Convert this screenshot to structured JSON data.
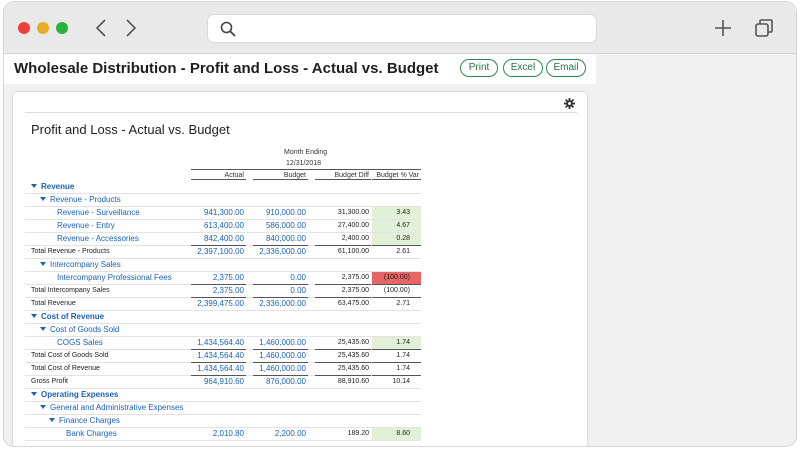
{
  "browser": {
    "url_placeholder": ""
  },
  "header": {
    "title": "Wholesale Distribution - Profit and Loss - Actual vs. Budget",
    "print": "Print",
    "excel": "Excel",
    "email": "Email"
  },
  "report": {
    "title": "Profit and Loss - Actual vs. Budget",
    "period_label": "Month Ending",
    "period_date": "12/31/2018",
    "columns": [
      "Actual",
      "Budget",
      "Budget Diff",
      "Budget % Var"
    ],
    "rows": [
      {
        "label": "Revenue",
        "level": 0,
        "style": "group",
        "caret": true
      },
      {
        "label": "Revenue - Products",
        "level": 1,
        "style": "group",
        "caret": true
      },
      {
        "label": "Revenue - Surveillance",
        "level": 2,
        "style": "item",
        "actual": "941,300.00",
        "budget": "910,000.00",
        "diff": "31,300.00",
        "var": "3.43",
        "var_color": "#e1f0d7"
      },
      {
        "label": "Revenue - Entry",
        "level": 2,
        "style": "item",
        "actual": "613,400.00",
        "budget": "586,000.00",
        "diff": "27,400.00",
        "var": "4.67",
        "var_color": "#e1f0d7"
      },
      {
        "label": "Revenue - Accessories",
        "level": 2,
        "style": "item",
        "actual": "842,400.00",
        "budget": "840,000.00",
        "diff": "2,400.00",
        "var": "0.28",
        "var_color": "#e1f0d7"
      },
      {
        "label": "Total Revenue - Products",
        "level": 0,
        "style": "total",
        "actual": "2,397,100.00",
        "budget": "2,336,000.00",
        "diff": "61,100.00",
        "var": "2.61",
        "var_color": ""
      },
      {
        "label": "Intercompany Sales",
        "level": 1,
        "style": "group",
        "caret": true
      },
      {
        "label": "Intercompany Professional Fees",
        "level": 2,
        "style": "item",
        "actual": "2,375.00",
        "budget": "0.00",
        "diff": "2,375.00",
        "var": "(100.00)",
        "var_color": "#e86565"
      },
      {
        "label": "Total Intercompany Sales",
        "level": 0,
        "style": "total",
        "actual": "2,375.00",
        "budget": "0.00",
        "diff": "2,375.00",
        "var": "(100.00)",
        "var_color": ""
      },
      {
        "label": "Total Revenue",
        "level": 0,
        "style": "total",
        "actual": "2,399,475.00",
        "budget": "2,336,000.00",
        "diff": "63,475.00",
        "var": "2.71",
        "var_color": ""
      },
      {
        "label": "Cost of Revenue",
        "level": 0,
        "style": "group",
        "caret": true
      },
      {
        "label": "Cost of Goods Sold",
        "level": 1,
        "style": "group",
        "caret": true
      },
      {
        "label": "COGS Sales",
        "level": 2,
        "style": "item",
        "actual": "1,434,564.40",
        "budget": "1,460,000.00",
        "diff": "25,435.60",
        "var": "1.74",
        "var_color": "#e1f0d7"
      },
      {
        "label": "Total Cost of Goods Sold",
        "level": 0,
        "style": "total",
        "actual": "1,434,564.40",
        "budget": "1,460,000.00",
        "diff": "25,435.60",
        "var": "1.74",
        "var_color": ""
      },
      {
        "label": "Total Cost of Revenue",
        "level": 0,
        "style": "total",
        "actual": "1,434,564.40",
        "budget": "1,460,000.00",
        "diff": "25,435.60",
        "var": "1.74",
        "var_color": ""
      },
      {
        "label": "Gross Profit",
        "level": 0,
        "style": "total",
        "actual": "964,910.60",
        "budget": "876,000.00",
        "diff": "88,910.60",
        "var": "10.14",
        "var_color": ""
      },
      {
        "label": "Operating Expenses",
        "level": 0,
        "style": "group",
        "caret": true
      },
      {
        "label": "General and Administrative Expenses",
        "level": 1,
        "style": "group",
        "caret": true
      },
      {
        "label": "Finance Charges",
        "level": 2,
        "style": "group",
        "caret": true
      },
      {
        "label": "Bank Charges",
        "level": 3,
        "style": "item",
        "actual": "2,010.80",
        "budget": "2,200.00",
        "diff": "189.20",
        "var": "8.60",
        "var_color": "#e1f0d7"
      }
    ]
  },
  "colors": {
    "accent_blue": "#1b63b4",
    "button_green": "#2e8a4a",
    "favorable": "#e1f0d7",
    "unfavorable": "#e86565"
  },
  "icons": [
    "search-icon",
    "chevron-left-icon",
    "chevron-right-icon",
    "plus-icon",
    "tabs-icon",
    "gear-icon",
    "caret-down-icon"
  ]
}
